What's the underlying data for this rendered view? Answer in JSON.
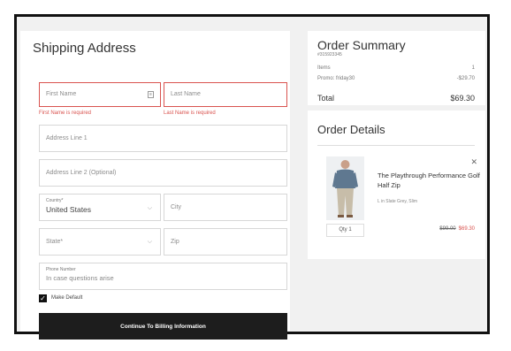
{
  "shipping": {
    "title": "Shipping Address",
    "first_name": {
      "placeholder": "First Name",
      "error": "First Name is required"
    },
    "last_name": {
      "placeholder": "Last Name",
      "error": "Last Name is required"
    },
    "address1": {
      "placeholder": "Address Line 1"
    },
    "address2": {
      "placeholder": "Address Line 2 (Optional)"
    },
    "country": {
      "label": "Country*",
      "value": "United States"
    },
    "city": {
      "placeholder": "City"
    },
    "state": {
      "placeholder": "State*"
    },
    "zip": {
      "placeholder": "Zip"
    },
    "phone": {
      "label": "Phone Number",
      "placeholder": "In case questions arise"
    },
    "make_default": {
      "label": "Make Default",
      "checked": true
    },
    "continue_label": "Continue To Billing Information"
  },
  "summary": {
    "title": "Order Summary",
    "order_number": "#315923345",
    "items_label": "Items",
    "items_count": "1",
    "promo_label": "Promo: friday30",
    "promo_amount": "-$29.70",
    "total_label": "Total",
    "total_amount": "$69.30"
  },
  "details": {
    "title": "Order Details",
    "product_name": "The Playthrough Performance Golf Half Zip",
    "variant": "L in Slate Grey, Slim",
    "qty": "Qty 1",
    "price_original": "$99.00",
    "price_sale": "$69.30"
  },
  "colors": {
    "error": "#d9534f",
    "button_bg": "#1d1d1d",
    "page_bg": "#f1f1f1"
  },
  "icons": {
    "close": "close-icon",
    "chevron": "chevron-down-icon",
    "check": "checkmark-icon",
    "autofill": "autofill-card-icon"
  }
}
